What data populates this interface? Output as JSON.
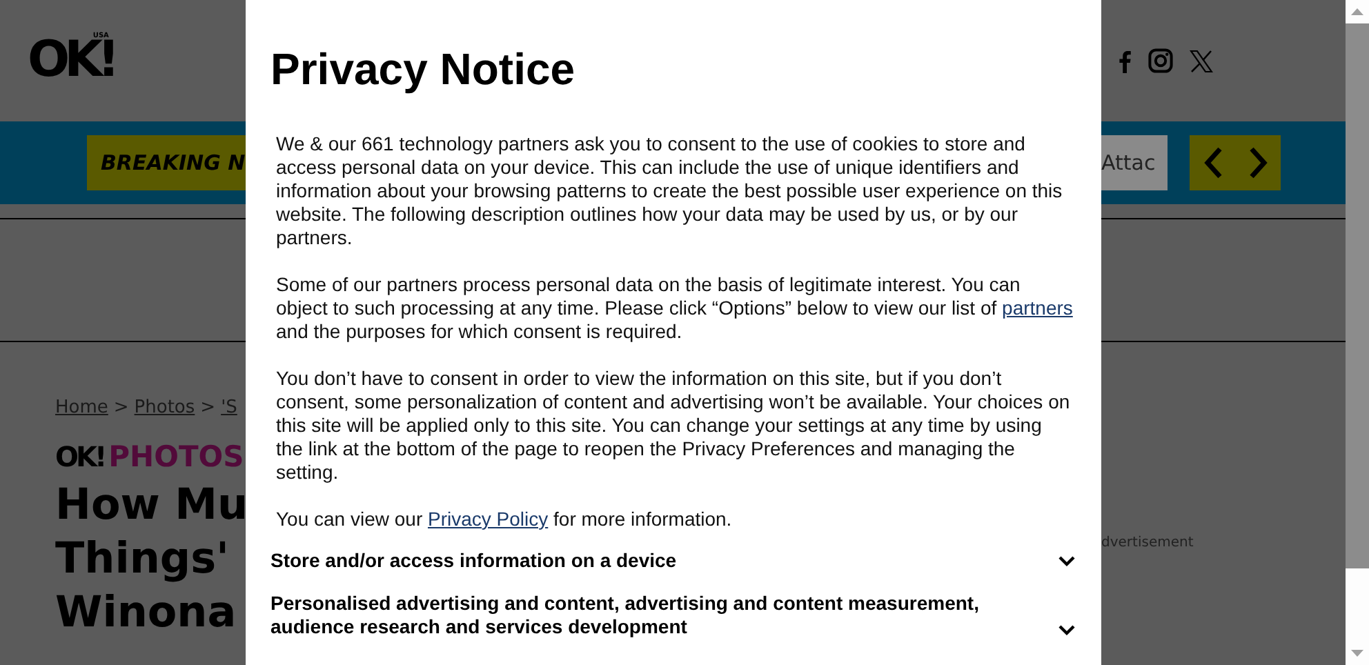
{
  "header": {
    "logo": "OK!",
    "logo_sub": "USA"
  },
  "ticker": {
    "label": "BREAKING N",
    "headline": "Attac"
  },
  "breadcrumb": [
    {
      "kind": "link",
      "text": "Home"
    },
    {
      "kind": "separator",
      "text": ">"
    },
    {
      "kind": "link",
      "text": "Photos"
    },
    {
      "kind": "separator",
      "text": ">"
    },
    {
      "kind": "link",
      "text": "'S"
    }
  ],
  "section_tag": {
    "logo": "OK!",
    "label": "PHOTOS"
  },
  "headline_lines": [
    "How Mu",
    "Things'",
    "Winona"
  ],
  "ad_label": "dvertisement",
  "modal": {
    "title": "Privacy Notice",
    "paragraphs": [
      [
        {
          "kind": "text",
          "text": "We & our 661 technology partners ask you to consent to the use of cookies to store and access personal data on your device. This can include the use of unique identifiers and information about your browsing patterns to create the best possible user experience on this website. The following description outlines how your data may be used by us, or by our partners."
        }
      ],
      [
        {
          "kind": "text",
          "text": "Some of our partners process personal data on the basis of legitimate interest. You can object to such processing at any time. Please click “Options” below to view our list of "
        },
        {
          "kind": "link",
          "text": "partners"
        },
        {
          "kind": "text",
          "text": " and the purposes for which consent is required."
        }
      ],
      [
        {
          "kind": "text",
          "text": "You don’t have to consent in order to view the information on this site, but if you don’t consent, some personalization of content and advertising won’t be available. Your choices on this site will be applied only to this site. You can change your settings at any time by using the link at the bottom of the page to reopen the Privacy Preferences and managing the setting."
        }
      ],
      [
        {
          "kind": "text",
          "text": "You can view our "
        },
        {
          "kind": "link",
          "text": "Privacy Policy"
        },
        {
          "kind": "text",
          "text": " for more information."
        }
      ]
    ],
    "purposes": [
      {
        "label": "Store and/or access information on a device",
        "expanded": false
      },
      {
        "label": "Personalised advertising and content, advertising and content measurement, audience research and services development",
        "expanded": false
      }
    ]
  }
}
